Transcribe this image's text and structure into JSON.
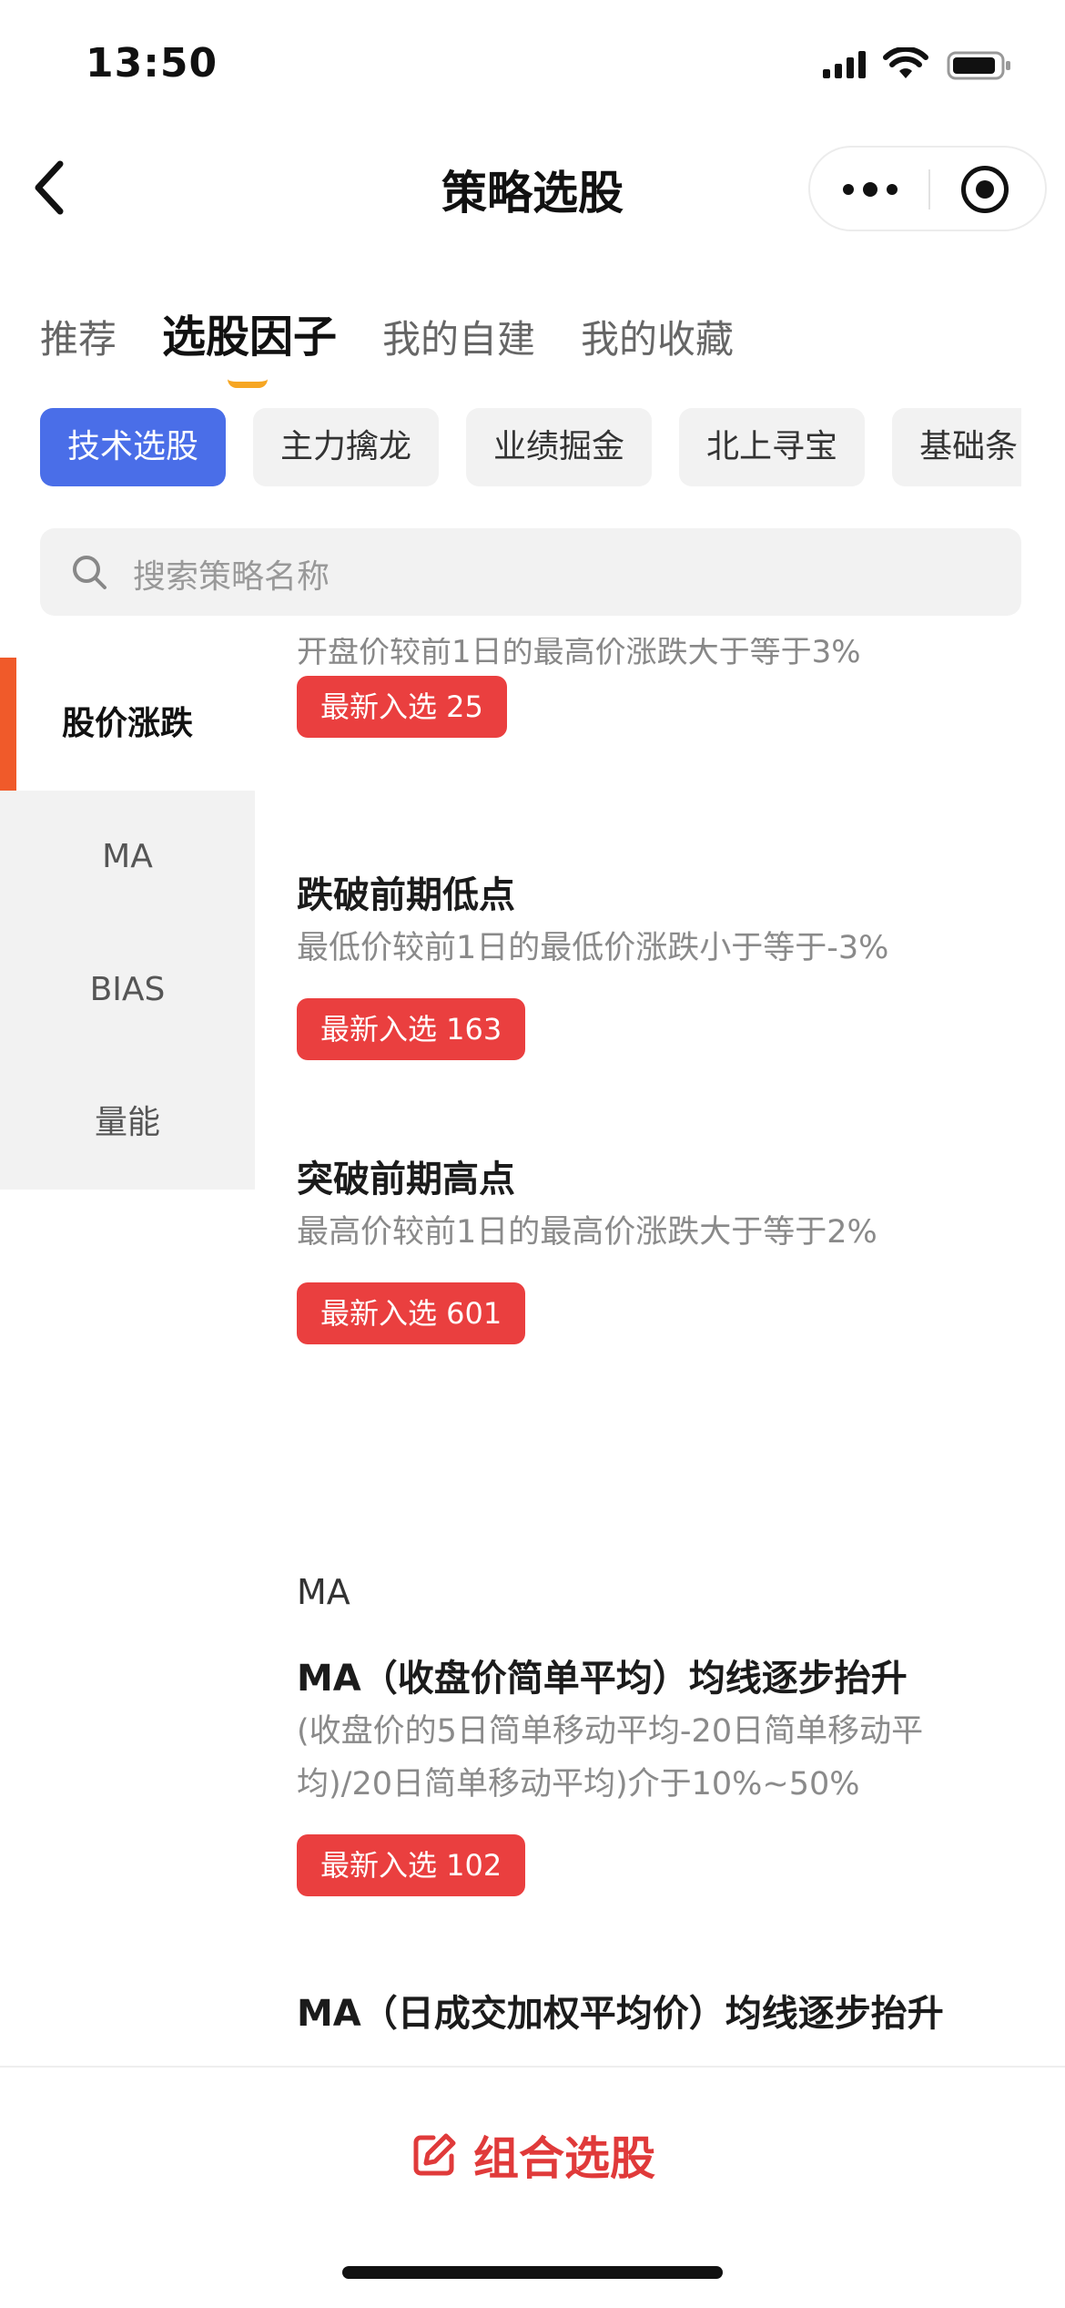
{
  "status_bar": {
    "time": "13:50"
  },
  "nav": {
    "title": "策略选股"
  },
  "tabs": [
    {
      "label": "推荐",
      "active": false
    },
    {
      "label": "选股因子",
      "active": true
    },
    {
      "label": "我的自建",
      "active": false
    },
    {
      "label": "我的收藏",
      "active": false
    }
  ],
  "chips": [
    {
      "label": "技术选股",
      "active": true
    },
    {
      "label": "主力擒龙",
      "active": false
    },
    {
      "label": "业绩掘金",
      "active": false
    },
    {
      "label": "北上寻宝",
      "active": false
    },
    {
      "label": "基础条",
      "active": false
    }
  ],
  "search": {
    "placeholder": "搜索策略名称"
  },
  "categories": [
    {
      "label": "股价涨跌",
      "active": true
    },
    {
      "label": "MA",
      "active": false
    },
    {
      "label": "BIAS",
      "active": false
    },
    {
      "label": "量能",
      "active": false
    }
  ],
  "content": {
    "clipped_desc": "开盘价较前1日的最高价涨跌大于等于3%",
    "clipped_badge": "最新入选 25",
    "items": [
      {
        "title": "跌破前期低点",
        "desc": "最低价较前1日的最低价涨跌小于等于-3%",
        "badge": "最新入选 163"
      },
      {
        "title": "突破前期高点",
        "desc": "最高价较前1日的最高价涨跌大于等于2%",
        "badge": "最新入选 601"
      }
    ],
    "section_ma": "MA",
    "ma_items": [
      {
        "title": "MA（收盘价简单平均）均线逐步抬升",
        "desc_line1": "(收盘价的5日简单移动平均-20日简单移动平",
        "desc_line2": "均)/20日简单移动平均)介于10%~50%",
        "badge": "最新入选 102"
      },
      {
        "title": "MA（日成交加权平均价）均线逐步抬升"
      }
    ]
  },
  "bottom": {
    "combo_label": "组合选股"
  },
  "colors": {
    "accent_blue": "#4a6ee8",
    "badge_red": "#ea3f3f",
    "tab_indicator": "#f6a623",
    "side_indicator": "#f05a2a"
  }
}
